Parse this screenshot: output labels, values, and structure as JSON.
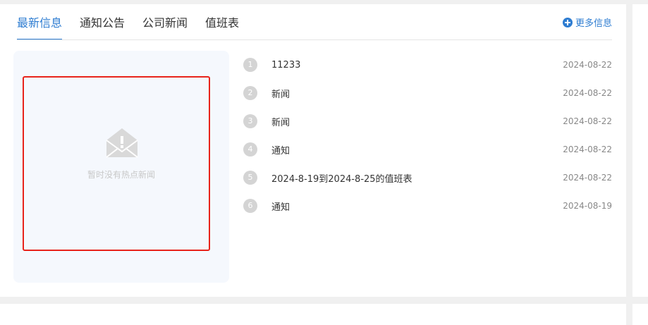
{
  "tabs": [
    {
      "label": "最新信息"
    },
    {
      "label": "通知公告"
    },
    {
      "label": "公司新闻"
    },
    {
      "label": "值班表"
    }
  ],
  "more_label": "更多信息",
  "hot_panel": {
    "empty_text": "暂时没有热点新闻"
  },
  "news": [
    {
      "index": "1",
      "title": "11233",
      "date": "2024-08-22"
    },
    {
      "index": "2",
      "title": "新闻",
      "date": "2024-08-22"
    },
    {
      "index": "3",
      "title": "新闻",
      "date": "2024-08-22"
    },
    {
      "index": "4",
      "title": "通知",
      "date": "2024-08-22"
    },
    {
      "index": "5",
      "title": "2024-8-19到2024-8-25的值班表",
      "date": "2024-08-22"
    },
    {
      "index": "6",
      "title": "通知",
      "date": "2024-08-19"
    }
  ],
  "colors": {
    "accent": "#2d7cd1",
    "highlight_border": "#e8231b",
    "panel_bg": "#f5f8fd"
  }
}
